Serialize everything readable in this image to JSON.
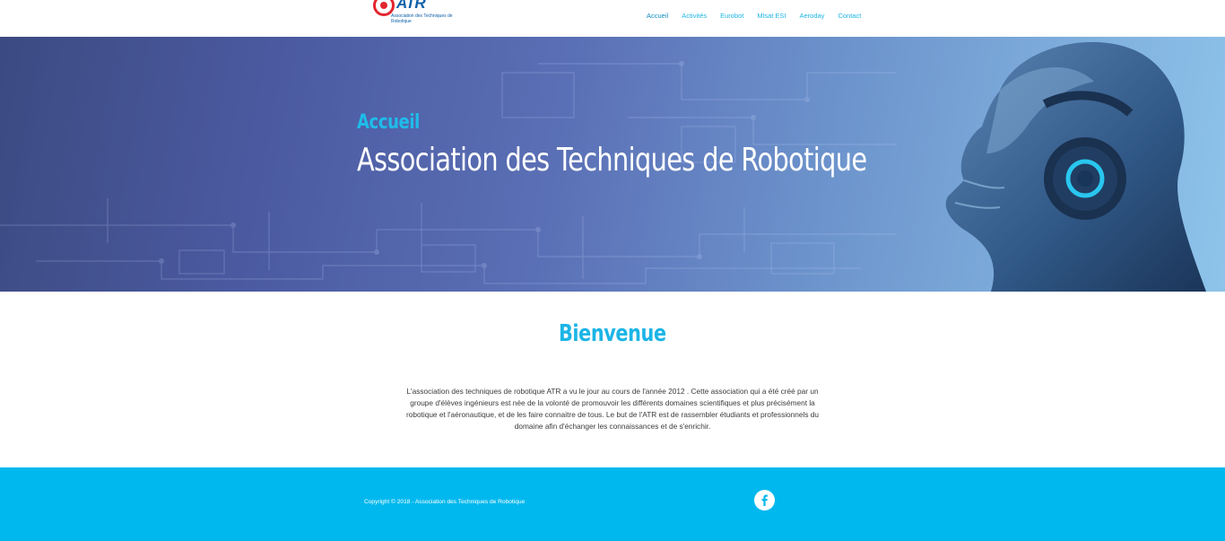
{
  "brand": {
    "logo_text": "ATR",
    "logo_subtitle": "Association des Techniques de Robotique",
    "colors": {
      "primary": "#1cb5e6",
      "footer": "#00b8ee",
      "logo_red": "#e3262e",
      "logo_blue": "#0c5fa8"
    }
  },
  "nav": {
    "items": [
      {
        "label": "Accueil",
        "active": true
      },
      {
        "label": "Activités",
        "active": false
      },
      {
        "label": "Eurobot",
        "active": false
      },
      {
        "label": "Mlsat ESI",
        "active": false
      },
      {
        "label": "Aeroday",
        "active": false
      },
      {
        "label": "Contact",
        "active": false
      }
    ]
  },
  "hero": {
    "kicker": "Accueil",
    "title": "Association des Techniques de Robotique"
  },
  "welcome": {
    "title": "Bienvenue",
    "text": "L'association des techniques de robotique ATR a vu le jour au cours de l'année 2012 . Cette association qui a été créé par un groupe d'élèves ingénieurs est née de la volonté de promouvoir les différents domaines scientifiques et plus précisément la robotique et l'aéronautique, et de les faire connaitre de tous. Le but de l'ATR est de rassembler étudiants et professionnels du domaine afin d'échanger les connaissances et de s'enrichir."
  },
  "footer": {
    "copyright": "Copyright © 2018 -  Association des Techniques de Robotique",
    "social_icon": "facebook-icon"
  }
}
